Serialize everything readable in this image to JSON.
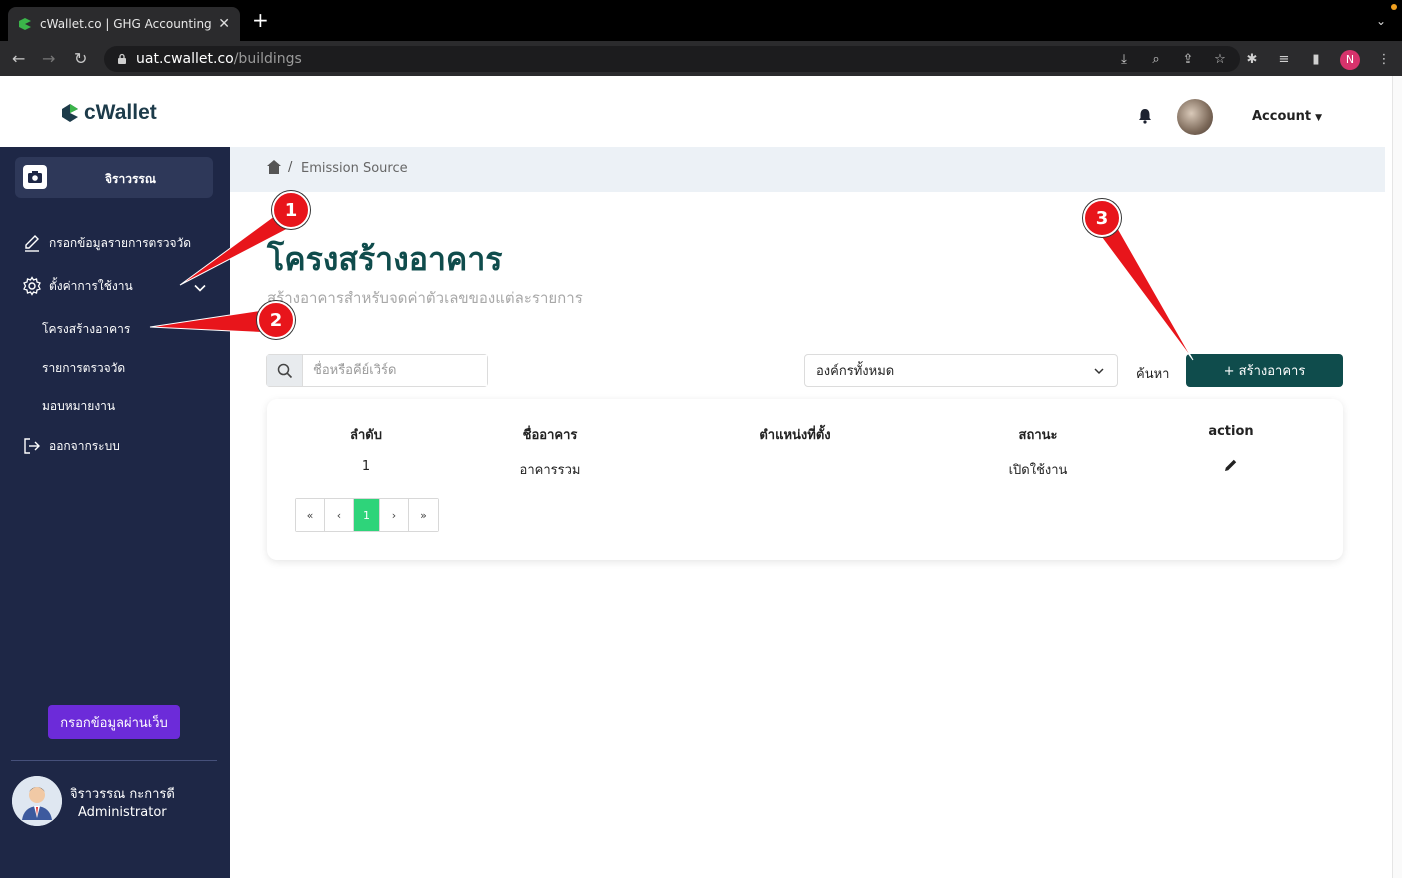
{
  "browser": {
    "tab_title": "cWallet.co | GHG Accounting S",
    "url_host": "uat.cwallet.co",
    "url_path": "/buildings",
    "profile_initial": "N"
  },
  "header": {
    "brand": "cWallet",
    "account_label": "Account"
  },
  "sidebar": {
    "user_chip_name": "จิราวรรณ",
    "items": [
      {
        "label": "กรอกข้อมูลรายการตรวจวัด",
        "icon": "pencil-icon"
      },
      {
        "label": "ตั้งค่าการใช้งาน",
        "icon": "gear-icon"
      },
      {
        "label": "ออกจากระบบ",
        "icon": "logout-icon"
      }
    ],
    "subitems": [
      {
        "label": "โครงสร้างอาคาร"
      },
      {
        "label": "รายการตรวจวัด"
      },
      {
        "label": "มอบหมายงาน"
      }
    ],
    "web_button": "กรอกข้อมูลผ่านเว็บ",
    "user_name": "จิราวรรณ กะการดี",
    "user_role": "Administrator"
  },
  "breadcrumb": {
    "separator": "/",
    "current": "Emission Source"
  },
  "main": {
    "title": "โครงสร้างอาคาร",
    "subtitle": "สร้างอาคารสำหรับจดค่าตัวเลขของแต่ละรายการ",
    "search_placeholder": "ชื่อหรือคีย์เวิร์ด",
    "org_select_value": "องค์กรทั้งหมด",
    "search_label": "ค้นหา",
    "create_button": "+ สร้างอาคาร"
  },
  "table": {
    "columns": [
      "ลำดับ",
      "ชื่ออาคาร",
      "ตำแหน่งที่ตั้ง",
      "สถานะ",
      "action"
    ],
    "rows": [
      {
        "no": "1",
        "name": "อาคารรวม",
        "location": "",
        "status": "เปิดใช้งาน"
      }
    ]
  },
  "pagination": {
    "first": "«",
    "prev": "‹",
    "current": "1",
    "next": "›",
    "last": "»"
  },
  "annotations": {
    "badge1": "1",
    "badge2": "2",
    "badge3": "3",
    "color": "#e8151b"
  },
  "colors": {
    "sidebar_bg": "#1e2746",
    "accent_teal": "#0f4c4c",
    "web_button_purple": "#6c2bd9",
    "pager_active": "#2ed47a"
  }
}
